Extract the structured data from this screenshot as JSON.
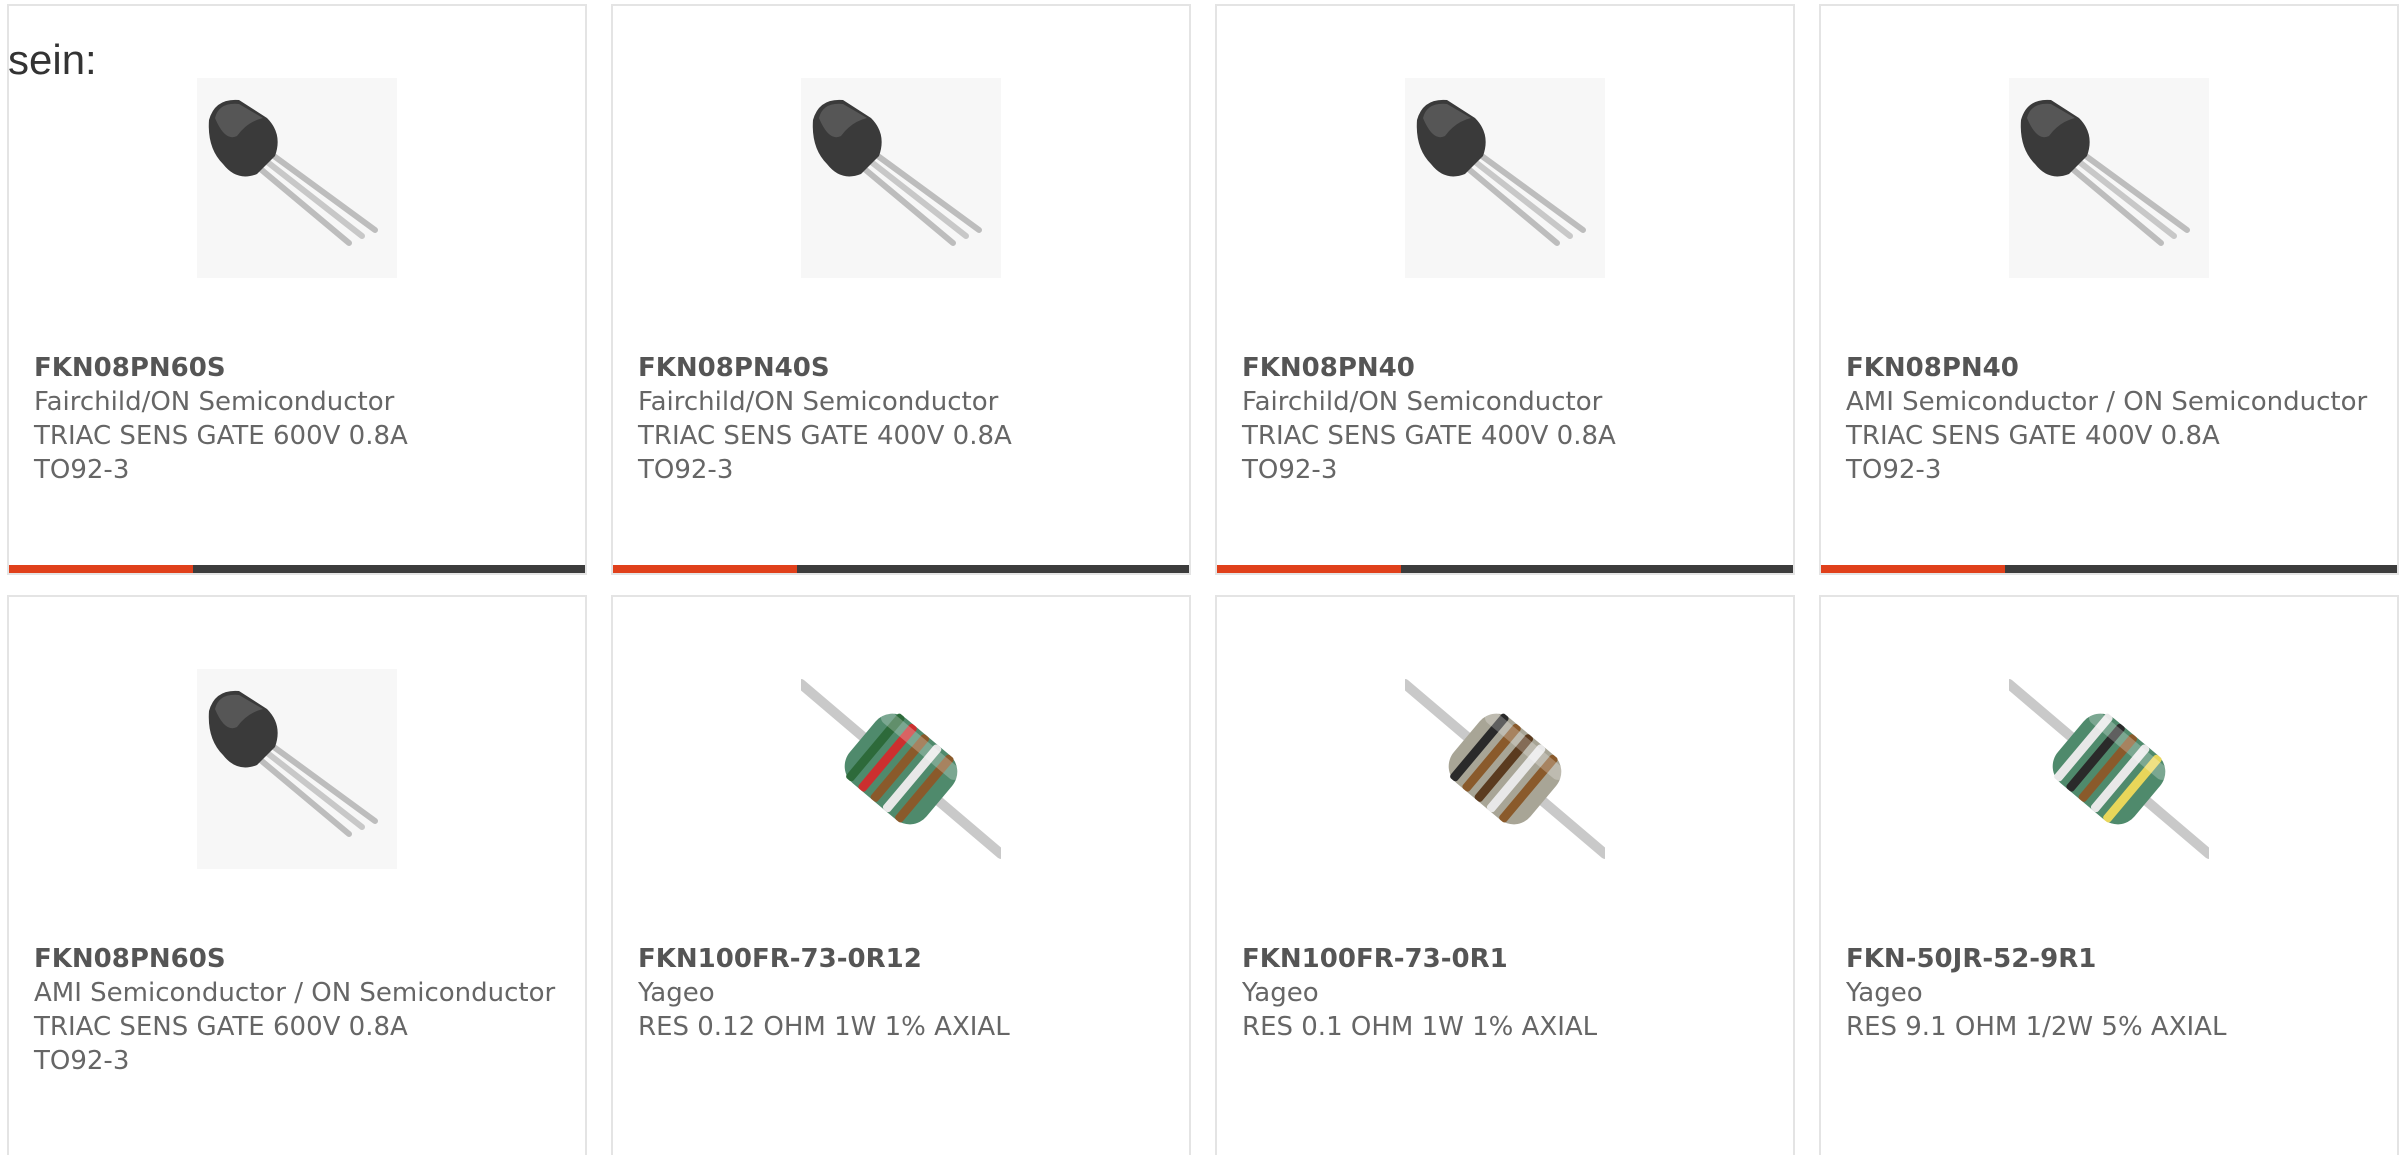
{
  "heading": "sein:",
  "colors": {
    "accent": "#e0401b",
    "bar": "#3c3c3c",
    "border": "#e4e4e4"
  },
  "products": [
    {
      "part": "FKN08PN60S",
      "maker": "Fairchild/ON Semiconductor",
      "desc": "TRIAC SENS GATE 600V 0.8A",
      "pkg": "TO92-3",
      "image": "to92-transistor-icon"
    },
    {
      "part": "FKN08PN40S",
      "maker": "Fairchild/ON Semiconductor",
      "desc": "TRIAC SENS GATE 400V 0.8A",
      "pkg": "TO92-3",
      "image": "to92-transistor-icon"
    },
    {
      "part": "FKN08PN40",
      "maker": "Fairchild/ON Semiconductor",
      "desc": "TRIAC SENS GATE 400V 0.8A",
      "pkg": "TO92-3",
      "image": "to92-transistor-icon"
    },
    {
      "part": "FKN08PN40",
      "maker": "AMI Semiconductor / ON Semiconductor",
      "desc": "TRIAC SENS GATE 400V 0.8A",
      "pkg": "TO92-3",
      "image": "to92-transistor-icon"
    },
    {
      "part": "FKN08PN60S",
      "maker": "AMI Semiconductor / ON Semiconductor",
      "desc": "TRIAC SENS GATE 600V 0.8A",
      "pkg": "TO92-3",
      "image": "to92-transistor-icon"
    },
    {
      "part": "FKN100FR-73-0R12",
      "maker": "Yageo",
      "desc": "RES 0.12 OHM 1W 1% AXIAL",
      "pkg": "",
      "image": "axial-resistor-icon",
      "body_color": "#4f8a6c",
      "bands": [
        "#2d6a3a",
        "#cc2f2f",
        "#8a5a2b",
        "#e8e8e8",
        "#8a5a2b"
      ]
    },
    {
      "part": "FKN100FR-73-0R1",
      "maker": "Yageo",
      "desc": "RES 0.1 OHM 1W 1% AXIAL",
      "pkg": "",
      "image": "axial-resistor-icon",
      "body_color": "#a8a596",
      "bands": [
        "#2a2a2a",
        "#8a5a2b",
        "#5b3b1f",
        "#e8e8e8",
        "#8a5a2b"
      ]
    },
    {
      "part": "FKN-50JR-52-9R1",
      "maker": "Yageo",
      "desc": "RES 9.1 OHM 1/2W 5% AXIAL",
      "pkg": "",
      "image": "axial-resistor-icon",
      "body_color": "#4f8a6c",
      "bands": [
        "#e8e8e8",
        "#2a2a2a",
        "#8a5a2b",
        "#e8e8e8",
        "#e8d65a"
      ]
    }
  ]
}
